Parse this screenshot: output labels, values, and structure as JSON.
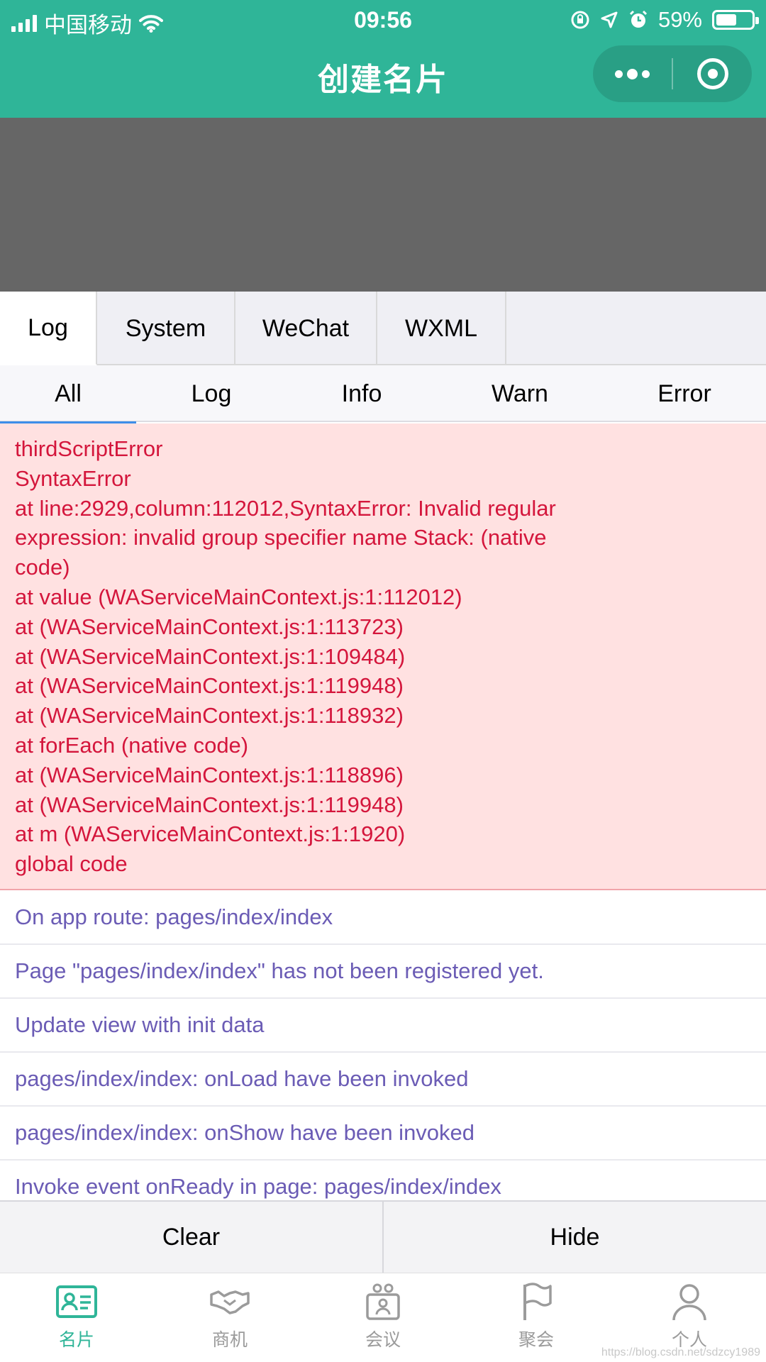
{
  "status_bar": {
    "carrier": "中国移动",
    "time": "09:56",
    "battery": "59%",
    "battery_level": 0.59
  },
  "nav": {
    "title": "创建名片",
    "more_icon": "more-dots-icon",
    "close_icon": "target-circle-icon"
  },
  "console_tabs": [
    {
      "label": "Log",
      "active": true
    },
    {
      "label": "System",
      "active": false
    },
    {
      "label": "WeChat",
      "active": false
    },
    {
      "label": "WXML",
      "active": false
    }
  ],
  "filter_tabs": [
    {
      "label": "All",
      "active": true
    },
    {
      "label": "Log",
      "active": false
    },
    {
      "label": "Info",
      "active": false
    },
    {
      "label": "Warn",
      "active": false
    },
    {
      "label": "Error",
      "active": false
    }
  ],
  "error_lines": [
    "thirdScriptError",
    "SyntaxError",
    "at line:2929,column:112012,SyntaxError: Invalid regular",
    "expression: invalid group specifier name Stack: (native",
    "code)",
    "at value (WAServiceMainContext.js:1:112012)",
    "at (WAServiceMainContext.js:1:113723)",
    "at (WAServiceMainContext.js:1:109484)",
    "at (WAServiceMainContext.js:1:119948)",
    "at (WAServiceMainContext.js:1:118932)",
    "at forEach (native code)",
    "at (WAServiceMainContext.js:1:118896)",
    "at (WAServiceMainContext.js:1:119948)",
    "at m (WAServiceMainContext.js:1:1920)",
    "global code"
  ],
  "log_rows": [
    "On app route: pages/index/index",
    "Page \"pages/index/index\" has not been registered yet.",
    "Update view with init data",
    "pages/index/index: onLoad have been invoked",
    "pages/index/index: onShow have been invoked",
    "Invoke event onReady in page: pages/index/index"
  ],
  "actions": {
    "clear": "Clear",
    "hide": "Hide"
  },
  "tab_bar": [
    {
      "label": "名片",
      "icon": "card-icon",
      "active": true
    },
    {
      "label": "商机",
      "icon": "handshake-icon",
      "active": false
    },
    {
      "label": "会议",
      "icon": "meeting-icon",
      "active": false
    },
    {
      "label": "聚会",
      "icon": "flag-icon",
      "active": false
    },
    {
      "label": "个人",
      "icon": "person-icon",
      "active": false
    }
  ],
  "watermark": "https://blog.csdn.net/sdzcy1989",
  "colors": {
    "brand_green": "#2fb598",
    "error_text": "#d4163c",
    "error_bg": "#ffe1e1",
    "log_text": "#6b5cb5",
    "active_underline": "#3e8ee9"
  }
}
